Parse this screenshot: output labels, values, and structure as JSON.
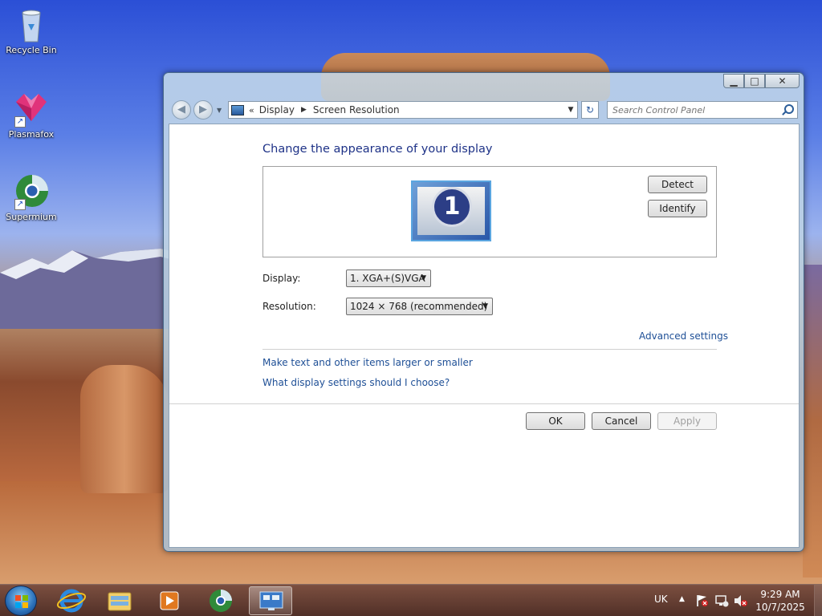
{
  "desktop": {
    "icons": [
      {
        "label": "Recycle Bin"
      },
      {
        "label": "Plasmafox"
      },
      {
        "label": "Supermium"
      }
    ]
  },
  "window": {
    "breadcrumb": {
      "chevron": "«",
      "items": [
        "Display",
        "Screen Resolution"
      ]
    },
    "search": {
      "placeholder": "Search Control Panel"
    },
    "heading": "Change the appearance of your display",
    "monitor": {
      "number": "1"
    },
    "detect_label": "Detect",
    "identify_label": "Identify",
    "display": {
      "label": "Display:",
      "value": "1. XGA+(S)VGA"
    },
    "resolution": {
      "label": "Resolution:",
      "value": "1024 × 768 (recommended)"
    },
    "advanced_link": "Advanced settings",
    "link_larger_text": "Make text and other items larger or smaller",
    "link_which_settings": "What display settings should I choose?",
    "ok_label": "OK",
    "cancel_label": "Cancel",
    "apply_label": "Apply",
    "controls": {
      "minimize": "▁",
      "maximize": "□",
      "close": "✕"
    }
  },
  "taskbar": {
    "items": [
      "start-orb",
      "internet-explorer-icon",
      "file-explorer-icon",
      "media-player-icon",
      "supermium-icon",
      "screen-resolution-icon"
    ],
    "tray": {
      "language": "UK",
      "chevron": "▲"
    },
    "clock": {
      "time": "9:29 AM",
      "date": "10/7/2025"
    }
  },
  "colors": {
    "heading": "#1e3287",
    "link": "#1e4f96"
  }
}
